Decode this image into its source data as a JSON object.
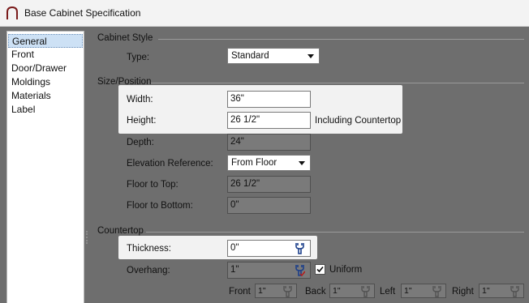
{
  "window": {
    "title": "Base Cabinet Specification"
  },
  "sidebar": {
    "items": [
      {
        "label": "General",
        "selected": true
      },
      {
        "label": "Front"
      },
      {
        "label": "Door/Drawer"
      },
      {
        "label": "Moldings"
      },
      {
        "label": "Materials"
      },
      {
        "label": "Label"
      }
    ]
  },
  "cabinet_style": {
    "heading": "Cabinet Style",
    "type_label": "Type:",
    "type_value": "Standard"
  },
  "size_position": {
    "heading": "Size/Position",
    "width_label": "Width:",
    "width_value": "36\"",
    "height_label": "Height:",
    "height_value": "26 1/2\"",
    "height_note": "Including Countertop",
    "depth_label": "Depth:",
    "depth_value": "24\"",
    "elevation_label": "Elevation Reference:",
    "elevation_value": "From Floor",
    "floor_top_label": "Floor to Top:",
    "floor_top_value": "26 1/2\"",
    "floor_bottom_label": "Floor to Bottom:",
    "floor_bottom_value": "0\""
  },
  "countertop": {
    "heading": "Countertop",
    "thickness_label": "Thickness:",
    "thickness_value": "0\"",
    "overhang_label": "Overhang:",
    "overhang_value": "1\"",
    "uniform_label": "Uniform",
    "uniform_checked": true,
    "front_label": "Front",
    "front_value": "1\"",
    "back_label": "Back",
    "back_value": "1\"",
    "left_label": "Left",
    "left_value": "1\"",
    "right_label": "Right",
    "right_value": "1\""
  },
  "colors": {
    "panel_bg": "#6e6e6e",
    "highlight": "#f2f2f2",
    "selected_item": "#cde1f5"
  }
}
